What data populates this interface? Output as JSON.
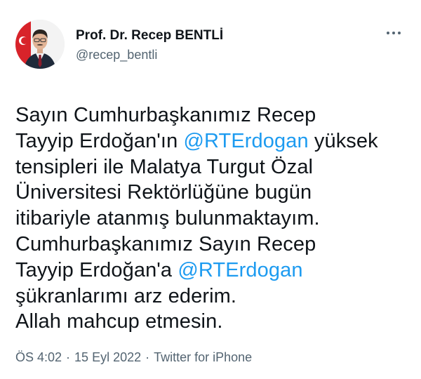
{
  "author": {
    "display_name": "Prof. Dr. Recep BENTLİ",
    "handle": "@recep_bentli"
  },
  "more_icon": "more-horizontal-icon",
  "tweet": {
    "lines": [
      [
        {
          "text": "Sayın Cumhurbaşkanımız Recep"
        }
      ],
      [
        {
          "text": "Tayyip Erdoğan'ın "
        },
        {
          "text": "@RTErdogan",
          "mention": true
        },
        {
          "text": " yüksek"
        }
      ],
      [
        {
          "text": "tensipleri ile Malatya Turgut Özal"
        }
      ],
      [
        {
          "text": "Üniversitesi Rektörlüğüne bugün"
        }
      ],
      [
        {
          "text": "itibariyle atanmış bulunmaktayım."
        }
      ],
      [
        {
          "text": "Cumhurbaşkanımız Sayın Recep"
        }
      ],
      [
        {
          "text": "Tayyip Erdoğan'a "
        },
        {
          "text": "@RTErdogan",
          "mention": true
        }
      ],
      [
        {
          "text": "şükranlarımı arz ederim."
        }
      ],
      [
        {
          "text": "Allah mahcup etmesin."
        }
      ]
    ]
  },
  "meta": {
    "time": "ÖS 4:02",
    "separator": "·",
    "date": "15 Eyl 2022",
    "source": "Twitter for iPhone"
  },
  "colors": {
    "mention": "#1d9bf0",
    "secondary_text": "#536471",
    "primary_text": "#0f1419"
  }
}
